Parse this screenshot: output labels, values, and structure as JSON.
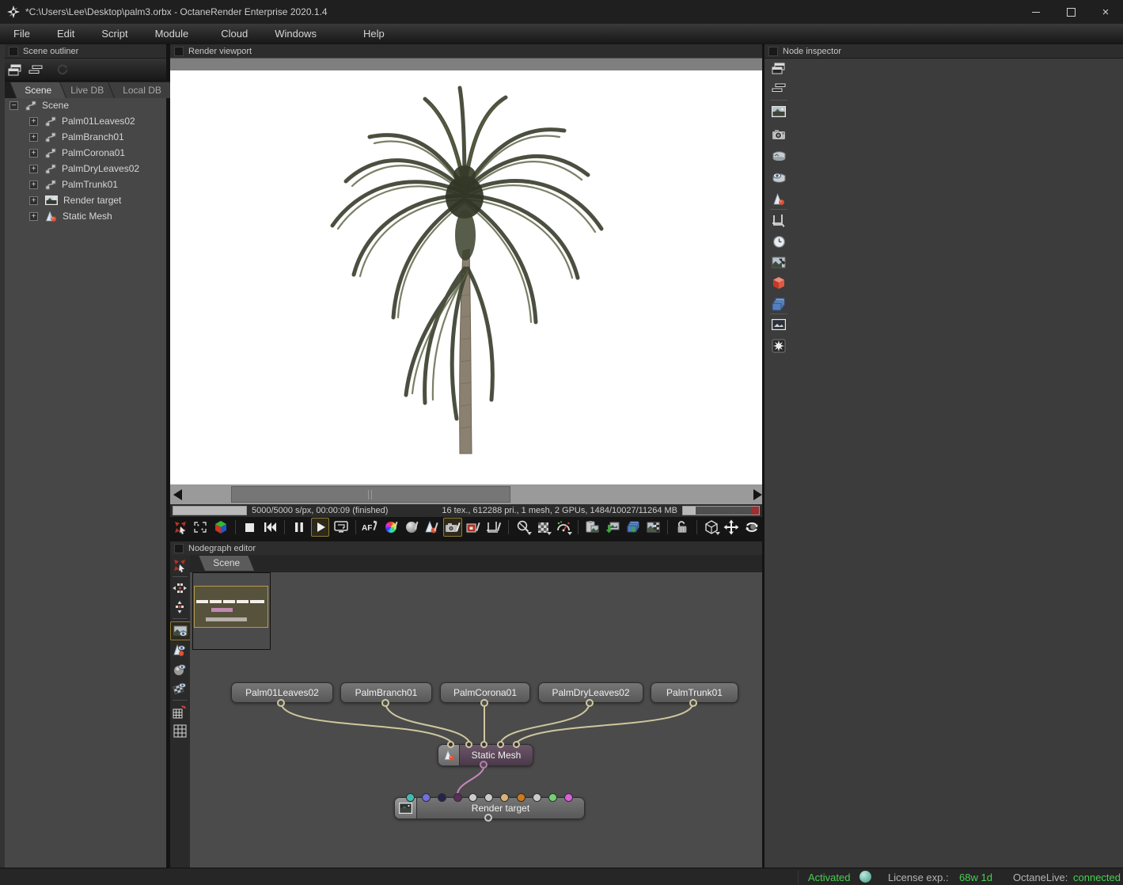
{
  "window": {
    "title": "*C:\\Users\\Lee\\Desktop\\palm3.orbx - OctaneRender Enterprise 2020.1.4",
    "controls": {
      "minimize": "–",
      "maximize": "",
      "close": "×"
    }
  },
  "menu": {
    "items": [
      "File",
      "Edit",
      "Script",
      "Module",
      "Cloud",
      "Windows",
      "Help"
    ]
  },
  "scene_outliner": {
    "title": "Scene outliner",
    "tabs": {
      "scene": "Scene",
      "live_db": "Live DB",
      "local_db": "Local DB"
    },
    "root_label": "Scene",
    "items": [
      "Palm01Leaves02",
      "PalmBranch01",
      "PalmCorona01",
      "PalmDryLeaves02",
      "PalmTrunk01",
      "Render target",
      "Static Mesh"
    ],
    "toolbar_icons": [
      "new-window-icon",
      "arrange-windows-icon",
      "refresh-icon"
    ]
  },
  "render_viewport": {
    "title": "Render viewport",
    "progress_text": "5000/5000 s/px, 00:00:09 (finished)",
    "stats_text": "16 tex., 612288 pri., 1 mesh, 2 GPUs, 1484/10027/11264 MB",
    "toolbar_icons": [
      "pick-focus-icon",
      "fit-view-icon",
      "rgb-cube-icon",
      "stop-icon",
      "restart-icon",
      "pause-icon",
      "play-icon",
      "monitor-icon",
      "autofocus-picker-icon",
      "white-balance-picker-icon",
      "material-picker-icon",
      "object-picker-icon",
      "camera-picker-icon",
      "render-region-picker-icon",
      "film-region-picker-icon",
      "lens-menu-icon",
      "alpha-mode-icon",
      "render-priority-icon",
      "copy-image-icon",
      "save-image-icon",
      "save-layers-icon",
      "save-passes-icon",
      "lock-icon",
      "camera-mode-icon",
      "pan-icon",
      "orbit-icon"
    ]
  },
  "nodegraph": {
    "title": "Nodegraph editor",
    "tab": "Scene",
    "palm_nodes": [
      "Palm01Leaves02",
      "PalmBranch01",
      "PalmCorona01",
      "PalmDryLeaves02",
      "PalmTrunk01"
    ],
    "static_mesh_label": "Static Mesh",
    "render_target_label": "Render target",
    "wire_color": "#cfc79e",
    "mesh_wire_color": "#c887c0",
    "render_target_port_colors": [
      "#3fbdb4",
      "#7070e0",
      "#23234d",
      "#5c2e57",
      "#cccccc",
      "#cccccc",
      "#dcb278",
      "#cd7a1a",
      "#cccccc",
      "#74cf74",
      "#da5ede"
    ],
    "strip_icons": [
      "recenter-icon",
      "spread-horizontal-icon",
      "spread-vertical-icon",
      "rendertarget-preview-icon",
      "material-preview-icon",
      "texture-preview-icon",
      "projection-preview-icon",
      "snap-grid-icon",
      "grid-icon"
    ]
  },
  "node_inspector": {
    "title": "Node inspector",
    "strip_icons": [
      "new-window-icon",
      "arrange-windows-icon",
      "rendertarget-icon",
      "camera-icon",
      "environment-icon",
      "visible-environment-icon",
      "mesh-icon",
      "film-settings-icon",
      "animation-icon",
      "kernel-icon",
      "object-layer-icon",
      "passes-icon",
      "imager-icon",
      "postprocessing-icon"
    ]
  },
  "status_bar": {
    "activated": "Activated",
    "license_label": "License exp.:",
    "license_value": "68w 1d",
    "octanelive_label": "OctaneLive:",
    "octanelive_value": "connected",
    "accent_green": "#49cf52"
  }
}
